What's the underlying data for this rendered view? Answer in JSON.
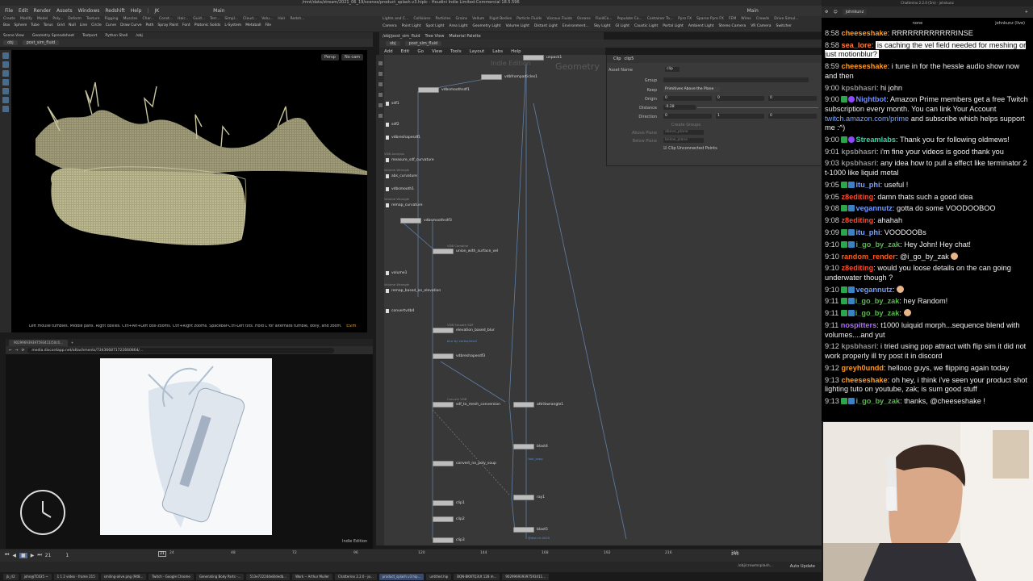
{
  "window": {
    "title": "/mnt/data/stream/2021_06_19/scenes/product_splash.v3.hiplc - Houdini Indie Limited-Commercial 18.5.596"
  },
  "menubar": {
    "items": [
      "File",
      "Edit",
      "Render",
      "Assets",
      "Windows",
      "Redshift",
      "Help"
    ],
    "desktop": "JK",
    "desk_main": "Main",
    "right_main": "Main"
  },
  "shelf_left": {
    "tabs": [
      "Create",
      "Modify",
      "Model",
      "Poly...",
      "Deform",
      "Texture",
      "Rigging",
      "Muscles",
      "Char...",
      "Const...",
      "Hair...",
      "Guid...",
      "Terr...",
      "Simpl...",
      "Cloud...",
      "Volu...",
      "Hair",
      "Redsh..."
    ],
    "tools": [
      "Box",
      "Sphere",
      "Tube",
      "Torus",
      "Grid",
      "Null",
      "Line",
      "Circle",
      "Curve",
      "Draw Curve",
      "Path",
      "Spray Paint",
      "Font",
      "Platonic Solids",
      "L-System",
      "Metaball",
      "File"
    ]
  },
  "shelf_right": {
    "tabs": [
      "Lights and C...",
      "Collisions",
      "Particles",
      "Grains",
      "Vellum",
      "Rigid Bodies",
      "Particle Fluids",
      "Viscous Fluids",
      "Oceans",
      "FluidCo...",
      "Populate Co...",
      "Container To...",
      "Pyro FX",
      "Sparse Pyro FX",
      "FEM",
      "Wires",
      "Crowds",
      "Drive Simul..."
    ],
    "tools": [
      "Camera",
      "Point Light",
      "Spot Light",
      "Area Light",
      "Geometry Light",
      "Volume Light",
      "Distant Light",
      "Environment...",
      "Sky Light",
      "GI Light",
      "Caustic Light",
      "Portal Light",
      "Ambient Light",
      "Stereo Camera",
      "VR Camera",
      "Switcher"
    ]
  },
  "viewport": {
    "tabs": [
      "Scene View",
      "Geometry Spreadsheet",
      "Textport",
      "Python Shell",
      "/obj"
    ],
    "path": [
      "obj",
      "post_sim_fluid"
    ],
    "persp": "Persp",
    "cam": "No cam",
    "hint": "Left mouse tumbles. Middle pans. Right dollies. Ctrl+Alt+Left box-zooms. Ctrl+Right zooms. Spacebar-Ctrl-Left tilts. Hold L for alternate tumble, dolly, and zoom.",
    "hint_tag": "ESim"
  },
  "browser": {
    "tab_title": "902996939397593411/50c0...",
    "url": "media.discordapp.net/attachments/734366871722660864/...",
    "indie_label": "Indie Edition"
  },
  "network": {
    "tabs": [
      "/obj/post_sim_fluid",
      "Tree View",
      "Material Palette"
    ],
    "path": [
      "obj",
      "post_sim_fluid"
    ],
    "menu": [
      "Add",
      "Edit",
      "Go",
      "View",
      "Tools",
      "Layout",
      "Labs",
      "Help"
    ],
    "watermark_indie": "Indie Edition",
    "watermark_geo": "Geometry",
    "nodes": [
      {
        "name": "unpack1",
        "sub": ""
      },
      {
        "name": "vdbfromparticles1",
        "sub": ""
      },
      {
        "name": "vdbsmoothsdf1",
        "sub": ""
      },
      {
        "name": "sdf1",
        "sub": ""
      },
      {
        "name": "measure_sdf_curvature",
        "sub": "VDB Analysis"
      },
      {
        "name": "abs_curvature",
        "sub": "Volume Wrangle"
      },
      {
        "name": "vdbsmooth1",
        "sub": ""
      },
      {
        "name": "remap_curvature",
        "sub": "Volume Wrangle"
      },
      {
        "name": "vdbsmoothsdf3",
        "sub": ""
      },
      {
        "name": "union_with_surface_vel",
        "sub": "VDB Combine"
      },
      {
        "name": "volume1",
        "sub": ""
      },
      {
        "name": "remap_based_on_elevation",
        "sub": "Volume Wrangle"
      },
      {
        "name": "convertvdb4",
        "sub": ""
      },
      {
        "name": "elevation_based_blur",
        "sub": "VDB Smooth SDF"
      },
      {
        "name": "vdbreshapesdf3",
        "sub": ""
      },
      {
        "name": "sdf_to_mesh_conversion",
        "sub": "Convert VDB"
      },
      {
        "name": "attribwrangle1",
        "sub": ""
      },
      {
        "name": "blast4",
        "sub": ""
      },
      {
        "name": "convert_no_poly_soup",
        "sub": ""
      },
      {
        "name": "ray1",
        "sub": ""
      },
      {
        "name": "clip1",
        "sub": ""
      },
      {
        "name": "clip2",
        "sub": ""
      },
      {
        "name": "blast5",
        "sub": ""
      },
      {
        "name": "clip3",
        "sub": ""
      },
      {
        "name": "vdbreshapesdf1",
        "sub": ""
      },
      {
        "name": "sdf2",
        "sub": ""
      }
    ],
    "blue_labels": {
      "blur": "blur by vortex/level",
      "blast4": "!bkt_keep",
      "blast5": "@dist<0.0025"
    }
  },
  "params": {
    "node_type": "Clip",
    "node_name": "clip5",
    "asset_name_label": "Asset Name",
    "asset_name_value": "clip",
    "group_label": "Group",
    "keep_label": "Keep",
    "keep_value": "Primitives Above the Plane",
    "origin_label": "Origin",
    "origin_values": [
      "0",
      "0",
      "0"
    ],
    "distance_label": "Distance",
    "distance_value": "-0.28",
    "direction_label": "Direction",
    "direction_values": [
      "0",
      "1",
      "0"
    ],
    "create_groups": "Create Groups",
    "above_plane_label": "Above Plane",
    "above_plane_value": "above_plane",
    "below_plane_label": "Below Plane",
    "below_plane_value": "below_plane",
    "clip_unconnected": "Clip Unconnected Points"
  },
  "timeline": {
    "frame": "21",
    "start": "1",
    "ticks": [
      "24",
      "48",
      "72",
      "96",
      "120",
      "144",
      "168",
      "192",
      "216",
      "240"
    ],
    "end1": "240",
    "end2": "240",
    "cursor": "21",
    "auto_update": "Auto Update",
    "path": "/obj/crowmsplash..."
  },
  "taskbar": {
    "items": [
      "jk_rl2",
      "john@TC635 ~",
      "1 1 2 video - frame 215",
      "smiling-olive.png (948...",
      "Twitch - Google Chrome",
      "Generating Body Parts -...",
      "513e722244e8/dedb...",
      "Work -- Arthur Muller",
      "Chatterino 2.2.0 - jo...",
      "product_splash.v3.hip...",
      "untitled.hip",
      "BQN-BKNTQ3Ut 128 m...",
      "902996939397593411..."
    ]
  },
  "chat": {
    "window_title": "Chatterino 2.2.0 (5m) - johnkunz",
    "channel": "johnkunz",
    "mode": "none",
    "live_label": "johnkunz (live)",
    "messages": [
      {
        "time": "8:58",
        "user": "cheeseshake",
        "color": "#ff9b22",
        "badges": [],
        "text": "RRRRRRRRRRRRINSE"
      },
      {
        "time": "8:58",
        "user": "sea_lore",
        "color": "#ff7a3c",
        "badges": [],
        "text": "is caching the vel field needed for meshing or just motionblur?",
        "highlight": true
      },
      {
        "time": "8:59",
        "user": "cheeseshake",
        "color": "#ff9b22",
        "badges": [],
        "text": "i tune in for the hessle audio show now and then"
      },
      {
        "time": "9:00",
        "user": "kpsbhasri",
        "color": "#8e8e8e",
        "badges": [],
        "text": "hi john"
      },
      {
        "time": "9:00",
        "user": "Nightbot",
        "color": "#6d8eff",
        "badges": [
          "green",
          "purple"
        ],
        "text": "Amazon Prime members get a free Twitch subscription every month. You can link Your Account",
        "link": "twitch.amazon.com/prime",
        "text2": "and subscribe which helps support me :^)"
      },
      {
        "time": "9:00",
        "user": "Streamlabs",
        "color": "#2fd8a5",
        "badges": [
          "green",
          "purple"
        ],
        "text": "Thank you for following oldmews!"
      },
      {
        "time": "9:01",
        "user": "kpsbhasri",
        "color": "#8e8e8e",
        "badges": [],
        "text": "i'm fine your videos is good thank you"
      },
      {
        "time": "9:03",
        "user": "kpsbhasri",
        "color": "#8e8e8e",
        "badges": [],
        "text": "any idea how to pull a effect like terminator 2 t-1000 like liquid metal"
      },
      {
        "time": "9:05",
        "user": "itu_phi",
        "color": "#7aa2ff",
        "badges": [
          "green",
          "blue"
        ],
        "text": "useful !"
      },
      {
        "time": "9:05",
        "user": "z8editing",
        "color": "#ff4a2a",
        "badges": [],
        "text": "damn thats such a good idea"
      },
      {
        "time": "9:08",
        "user": "vegannutz",
        "color": "#6f9bff",
        "badges": [
          "green",
          "blue"
        ],
        "text": "gotta do some VOODOOBOO"
      },
      {
        "time": "9:08",
        "user": "z8editing",
        "color": "#ff4a2a",
        "badges": [],
        "text": "ahahah"
      },
      {
        "time": "9:09",
        "user": "itu_phi",
        "color": "#7aa2ff",
        "badges": [
          "green",
          "blue"
        ],
        "text": "VOODOOBs"
      },
      {
        "time": "9:10",
        "user": "i_go_by_zak",
        "color": "#56b84a",
        "badges": [
          "green",
          "blue"
        ],
        "text": "Hey John! Hey chat!"
      },
      {
        "time": "9:10",
        "user": "random_render",
        "color": "#ff5c1a",
        "badges": [],
        "text": "@i_go_by_zak"
      },
      {
        "time": "9:10",
        "user": "z8editing",
        "color": "#ff4a2a",
        "badges": [],
        "text": "would you loose details on the can going underwater though ?"
      },
      {
        "time": "9:10",
        "user": "vegannutz",
        "color": "#6f9bff",
        "badges": [
          "green",
          "blue"
        ],
        "text": ""
      },
      {
        "time": "9:11",
        "user": "i_go_by_zak",
        "color": "#56b84a",
        "badges": [
          "green",
          "blue"
        ],
        "text": "hey Random!"
      },
      {
        "time": "9:11",
        "user": "i_go_by_zak",
        "color": "#56b84a",
        "badges": [
          "green",
          "blue"
        ],
        "text": ""
      },
      {
        "time": "9:11",
        "user": "nospitters",
        "color": "#b06aff",
        "badges": [],
        "text": "t1000 luiquid morph...sequence blend with volumes....and yut"
      },
      {
        "time": "9:12",
        "user": "kpsbhasri",
        "color": "#8e8e8e",
        "badges": [],
        "text": "i tried using pop attract with flip sim it did not work properly ill try post it in discord"
      },
      {
        "time": "9:12",
        "user": "greyh0undd",
        "color": "#ff9b22",
        "badges": [],
        "text": "hellooo guys, we flipping again today"
      },
      {
        "time": "9:13",
        "user": "cheeseshake",
        "color": "#ff9b22",
        "badges": [],
        "text": "oh hey, i think i've seen your product shot lighting tuto on youtube, zak; is sum good stuff"
      },
      {
        "time": "9:13",
        "user": "i_go_by_zak",
        "color": "#56b84a",
        "badges": [
          "green",
          "blue"
        ],
        "text": "thanks, @cheeseshake !"
      }
    ]
  },
  "colors": {
    "viewport_bg": "#000000",
    "network_bg": "#383838",
    "chat_bg": "#000000",
    "fluid": "#bdb894"
  }
}
